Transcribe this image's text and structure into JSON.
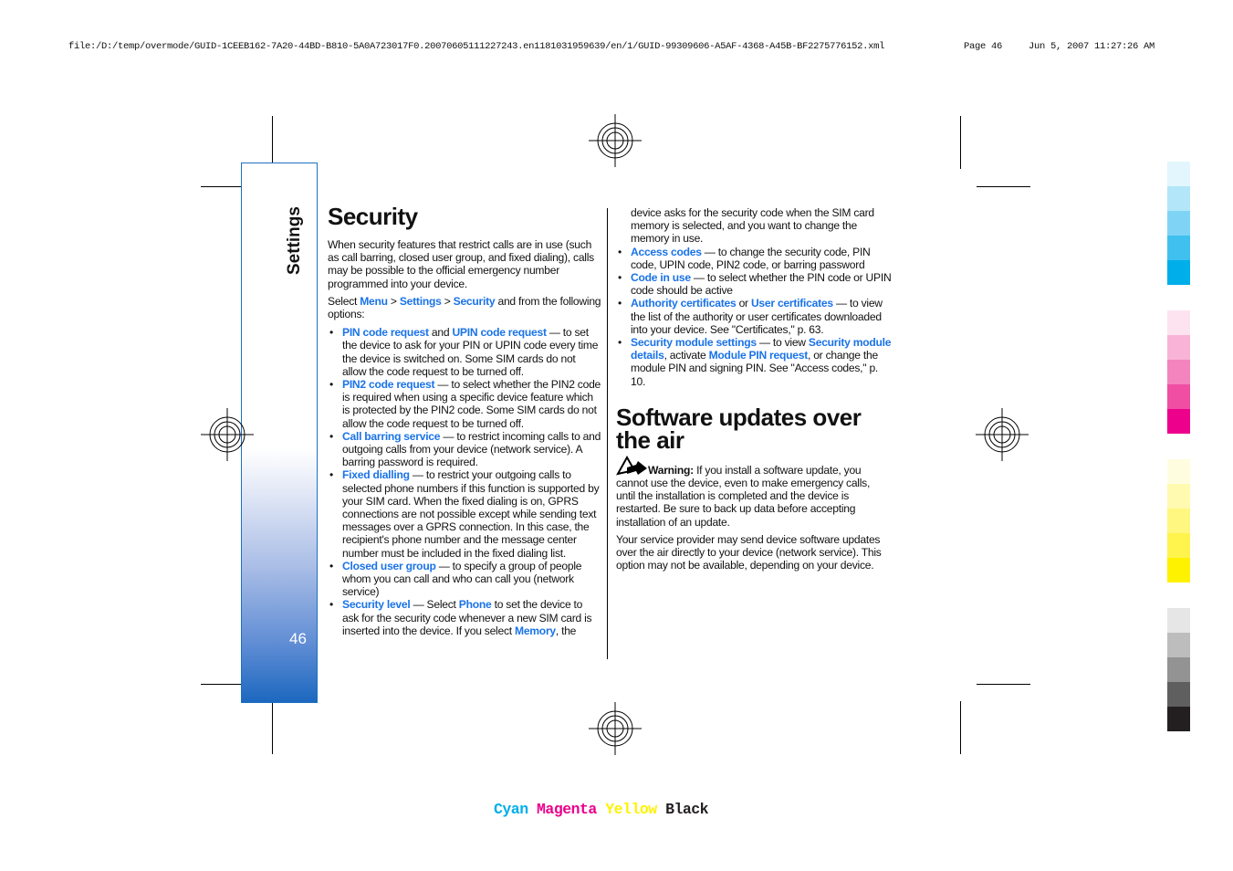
{
  "header": {
    "path": "file:/D:/temp/overmode/GUID-1CEEB162-7A20-44BD-B810-5A0A723017F0.20070605111227243.en1181031959639/en/1/GUID-99309606-A5AF-4368-A45B-BF2275776152.xml",
    "page": "Page 46",
    "datetime": "Jun 5, 2007 11:27:26 AM"
  },
  "sidebar": {
    "title": "Settings",
    "page_number": "46",
    "color": "#1c68bf"
  },
  "security": {
    "title": "Security",
    "intro": [
      {
        "t": "When security features that restrict calls are in use (such as call barring, closed user group, and fixed dialing), calls may be possible to the official emergency number programmed into your device."
      }
    ],
    "select": [
      {
        "t": "Select "
      },
      {
        "t": "Menu",
        "k": 1
      },
      {
        "t": "  >  "
      },
      {
        "t": "Settings",
        "k": 1
      },
      {
        "t": "  >  "
      },
      {
        "t": "Security",
        "k": 1
      },
      {
        "t": " and from the following options:"
      }
    ],
    "items": [
      [
        {
          "t": "PIN code request",
          "k": 1
        },
        {
          "t": " and "
        },
        {
          "t": "UPIN code request",
          "k": 1
        },
        {
          "t": " — to set the device to ask for your PIN or UPIN code every time the device is switched on. Some SIM cards do not allow the code request to be turned off."
        }
      ],
      [
        {
          "t": "PIN2 code request",
          "k": 1
        },
        {
          "t": " — to select whether the PIN2 code is required when using a specific device feature which is protected by the PIN2 code. Some SIM cards do not allow the code request to be turned off."
        }
      ],
      [
        {
          "t": "Call barring service",
          "k": 1
        },
        {
          "t": " — to restrict incoming calls to and outgoing calls from your device (network service). A barring password is required."
        }
      ],
      [
        {
          "t": "Fixed dialling",
          "k": 1
        },
        {
          "t": " — to restrict your outgoing calls to selected phone numbers if this function is supported by your SIM card. When the fixed dialing is on, GPRS connections are not possible except while sending text messages over a GPRS connection. In this case, the recipient's phone number and the message center number must be included in the fixed dialing list."
        }
      ],
      [
        {
          "t": "Closed user group",
          "k": 1
        },
        {
          "t": " — to specify a group of people whom you can call and who can call you (network service)"
        }
      ],
      [
        {
          "t": "Security level",
          "k": 1
        },
        {
          "t": " — Select "
        },
        {
          "t": "Phone",
          "k": 1
        },
        {
          "t": " to set the device to ask for the security code whenever a new SIM card is inserted into the device. If you select "
        },
        {
          "t": "Memory",
          "k": 1
        },
        {
          "t": ", the"
        }
      ]
    ],
    "continued": [
      {
        "t": "device asks for the security code when the SIM card memory is selected, and you want to change the memory in use."
      }
    ],
    "items2": [
      [
        {
          "t": "Access codes",
          "k": 1
        },
        {
          "t": " — to change the security code, PIN code, UPIN code, PIN2 code, or barring password"
        }
      ],
      [
        {
          "t": "Code in use",
          "k": 1
        },
        {
          "t": " — to select whether the PIN code or UPIN code should be active"
        }
      ],
      [
        {
          "t": "Authority certificates",
          "k": 1
        },
        {
          "t": " or "
        },
        {
          "t": "User certificates",
          "k": 1
        },
        {
          "t": " — to view the list of the authority or user certificates downloaded into your device. See \"Certificates,\" p. 63."
        }
      ],
      [
        {
          "t": "Security module settings",
          "k": 1
        },
        {
          "t": " — to view "
        },
        {
          "t": "Security module details",
          "k": 1
        },
        {
          "t": ", activate "
        },
        {
          "t": "Module PIN request",
          "k": 1
        },
        {
          "t": ", or change the module PIN and signing PIN. See \"Access codes,\" p. 10."
        }
      ]
    ]
  },
  "software": {
    "title": "Software updates over the air",
    "warning": [
      {
        "t": "Warning:",
        "b": 1
      },
      {
        "t": "  If you install a software update, you cannot use the device, even to make emergency calls, until the installation is completed and the device is restarted. Be sure to back up data before accepting installation of an update."
      }
    ],
    "body": [
      {
        "t": "Your service provider may send device software updates over the air directly to your device (network service). This option may not be available, depending on your device."
      }
    ]
  },
  "swatches": {
    "cyan": [
      "#e3f6fd",
      "#b3e6f9",
      "#7fd4f5",
      "#3fc0ef",
      "#00aeea"
    ],
    "magenta": [
      "#fde3f0",
      "#f8b3d6",
      "#f384bd",
      "#ef4ea3",
      "#ec008c"
    ],
    "yellow": [
      "#fffde0",
      "#fffab0",
      "#fff780",
      "#fff34d",
      "#fff200"
    ],
    "black": [
      "#e6e6e6",
      "#bdbdbd",
      "#939393",
      "#5f5f5f",
      "#231f20"
    ]
  },
  "footer": {
    "cyan": "Cyan",
    "magenta": "Magenta",
    "yellow": "Yellow",
    "black": "Black",
    "colors": {
      "cyan": "#00aeea",
      "magenta": "#ec008c",
      "yellow": "#fff200",
      "black": "#231f20"
    }
  },
  "link_color": "#1a73e8"
}
